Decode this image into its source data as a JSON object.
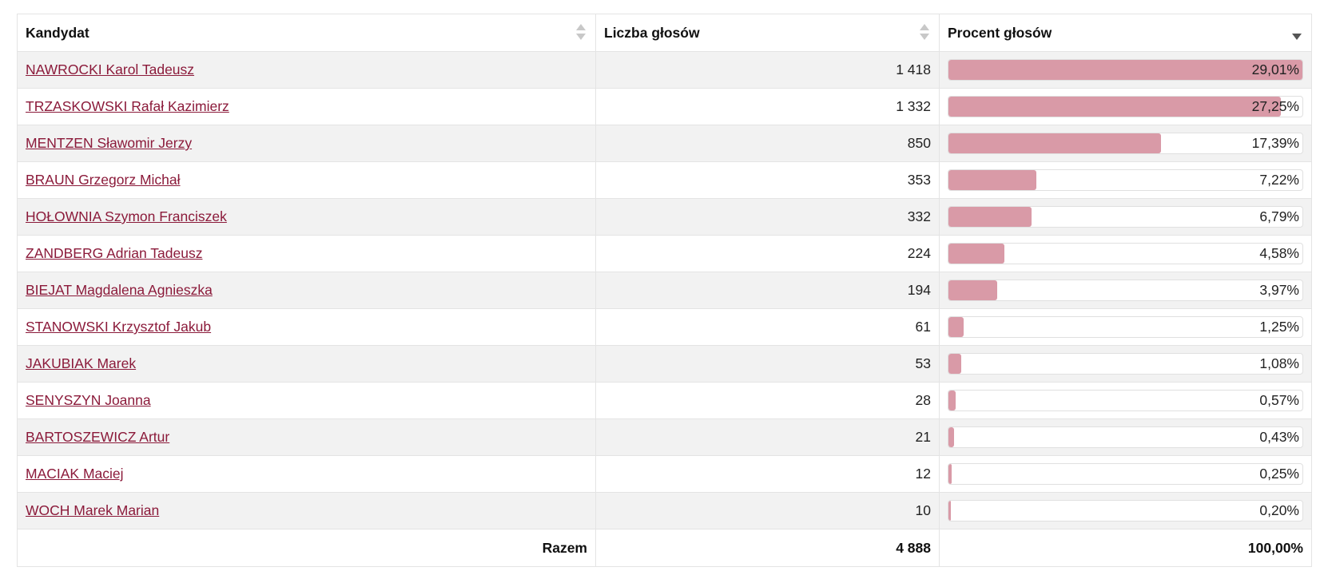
{
  "header": {
    "col_candidate": "Kandydat",
    "col_votes": "Liczba głosów",
    "col_percent": "Procent głosów"
  },
  "rows": [
    {
      "name": "NAWROCKI Karol Tadeusz",
      "votes": "1 418",
      "percent_label": "29,01%",
      "percent": 29.01
    },
    {
      "name": "TRZASKOWSKI Rafał Kazimierz",
      "votes": "1 332",
      "percent_label": "27,25%",
      "percent": 27.25
    },
    {
      "name": "MENTZEN Sławomir Jerzy",
      "votes": "850",
      "percent_label": "17,39%",
      "percent": 17.39
    },
    {
      "name": "BRAUN Grzegorz Michał",
      "votes": "353",
      "percent_label": "7,22%",
      "percent": 7.22
    },
    {
      "name": "HOŁOWNIA Szymon Franciszek",
      "votes": "332",
      "percent_label": "6,79%",
      "percent": 6.79
    },
    {
      "name": "ZANDBERG Adrian Tadeusz",
      "votes": "224",
      "percent_label": "4,58%",
      "percent": 4.58
    },
    {
      "name": "BIEJAT Magdalena Agnieszka",
      "votes": "194",
      "percent_label": "3,97%",
      "percent": 3.97
    },
    {
      "name": "STANOWSKI Krzysztof Jakub",
      "votes": "61",
      "percent_label": "1,25%",
      "percent": 1.25
    },
    {
      "name": "JAKUBIAK Marek",
      "votes": "53",
      "percent_label": "1,08%",
      "percent": 1.08
    },
    {
      "name": "SENYSZYN Joanna",
      "votes": "28",
      "percent_label": "0,57%",
      "percent": 0.57
    },
    {
      "name": "BARTOSZEWICZ Artur",
      "votes": "21",
      "percent_label": "0,43%",
      "percent": 0.43
    },
    {
      "name": "MACIAK Maciej",
      "votes": "12",
      "percent_label": "0,25%",
      "percent": 0.25
    },
    {
      "name": "WOCH Marek Marian",
      "votes": "10",
      "percent_label": "0,20%",
      "percent": 0.2
    }
  ],
  "footer": {
    "label": "Razem",
    "total_votes": "4 888",
    "total_percent": "100,00%"
  },
  "bar_scale_max_percent": 29.01,
  "colors": {
    "link": "#8b1a3a",
    "bar_fill": "#d99aa7",
    "row_alt": "#f2f2f2"
  }
}
